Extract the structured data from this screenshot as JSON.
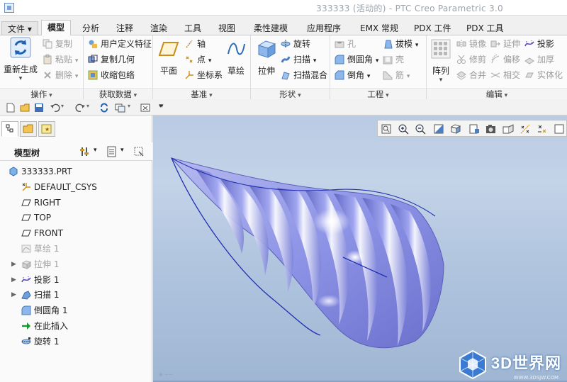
{
  "window": {
    "title": "333333 (活动的) - PTC Creo Parametric 3.0"
  },
  "tabs": [
    {
      "label": "文件",
      "has_menu": true
    },
    {
      "label": "模型",
      "active": true
    },
    {
      "label": "分析"
    },
    {
      "label": "注释"
    },
    {
      "label": "渲染"
    },
    {
      "label": "工具"
    },
    {
      "label": "视图"
    },
    {
      "label": "柔性建模"
    },
    {
      "label": "应用程序"
    },
    {
      "label": "EMX 常规"
    },
    {
      "label": "PDX 工件"
    },
    {
      "label": "PDX 工具"
    }
  ],
  "ribbon": {
    "operations": {
      "label": "操作",
      "regenerate": "重新生成",
      "copy": "复制",
      "paste": "粘贴",
      "delete": "删除"
    },
    "get_data": {
      "label": "获取数据",
      "user_feature": "用户定义特征",
      "copy_geometry": "复制几何",
      "shrinkwrap": "收缩包络"
    },
    "datum": {
      "label": "基准",
      "plane": "平面",
      "axis": "轴",
      "point": "点",
      "csys": "坐标系",
      "sketch": "草绘"
    },
    "shapes": {
      "label": "形状",
      "extrude": "拉伸",
      "revolve": "旋转",
      "sweep": "扫描",
      "swept_blend": "扫描混合"
    },
    "engineering": {
      "label": "工程",
      "hole": "孔",
      "round": "倒圆角",
      "chamfer": "倒角",
      "draft": "拔模",
      "shell": "壳",
      "rib": "筋"
    },
    "editing": {
      "label": "编辑",
      "pattern": "阵列",
      "mirror": "镜像",
      "trim": "修剪",
      "merge": "合并",
      "extend": "延伸",
      "offset": "偏移",
      "intersect": "相交",
      "project": "投影",
      "thicken": "加厚",
      "solidify": "实体化"
    }
  },
  "model_tree": {
    "title": "模型树",
    "items": [
      {
        "label": "333333.PRT",
        "icon": "part-icon",
        "expandable": false,
        "dim": false
      },
      {
        "label": "DEFAULT_CSYS",
        "icon": "csys-icon",
        "expandable": false,
        "dim": false
      },
      {
        "label": "RIGHT",
        "icon": "datum-plane-icon",
        "expandable": false,
        "dim": false
      },
      {
        "label": "TOP",
        "icon": "datum-plane-icon",
        "expandable": false,
        "dim": false
      },
      {
        "label": "FRONT",
        "icon": "datum-plane-icon",
        "expandable": false,
        "dim": false
      },
      {
        "label": "草绘 1",
        "icon": "sketch-icon",
        "expandable": false,
        "dim": true
      },
      {
        "label": "拉伸 1",
        "icon": "extrude-icon",
        "expandable": true,
        "dim": true
      },
      {
        "label": "投影 1",
        "icon": "project-icon",
        "expandable": true,
        "dim": false
      },
      {
        "label": "扫描 1",
        "icon": "sweep-icon",
        "expandable": true,
        "dim": false
      },
      {
        "label": "倒圆角 1",
        "icon": "round-icon",
        "expandable": false,
        "dim": false
      },
      {
        "label": "在此插入",
        "icon": "insert-here-icon",
        "expandable": false,
        "dim": false
      },
      {
        "label": "旋转 1",
        "icon": "revolve-icon",
        "expandable": false,
        "dim": false
      }
    ]
  },
  "viewport": {
    "watermark": "3D世界网",
    "watermark_url": "WWW.3DSJW.COM",
    "colors": {
      "model": "#8d93e6",
      "background_top": "#b9cbe3",
      "background_bottom": "#9fb6d3",
      "curve": "#1f2fb0"
    }
  },
  "colors": {
    "accent": "#2e6db5",
    "ribbon_bg": "#fbfbfb",
    "panel_bg": "#fafafa"
  }
}
